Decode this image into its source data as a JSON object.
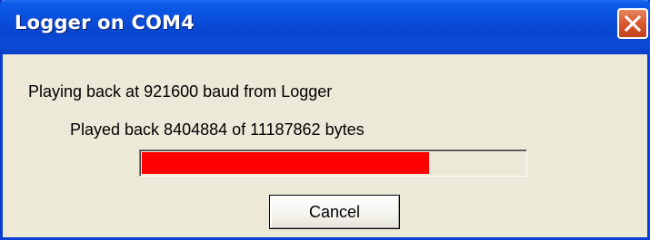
{
  "window": {
    "title": "Logger on COM4"
  },
  "status": {
    "message": "Playing back at 921600 baud from Logger",
    "progress_text": "Played back 8404884 of 11187862 bytes",
    "bytes_played": 8404884,
    "bytes_total": 11187862,
    "progress_fraction": 0.751,
    "progress_color": "#FF0000"
  },
  "buttons": {
    "cancel_label": "Cancel"
  },
  "icons": {
    "close": "close-icon"
  }
}
